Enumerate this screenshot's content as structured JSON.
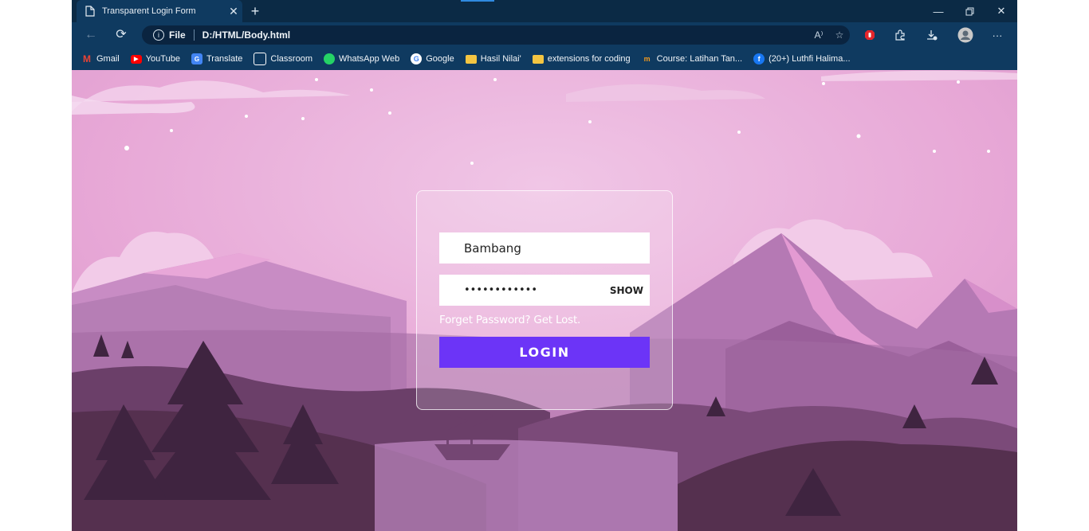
{
  "browser": {
    "tab_title": "Transparent Login Form",
    "new_tab": "+",
    "address": {
      "scheme_label": "File",
      "url": "D:/HTML/Body.html"
    }
  },
  "bookmarks": [
    {
      "label": "Gmail",
      "icon": "gmail-icon",
      "color": "#ea4335"
    },
    {
      "label": "YouTube",
      "icon": "youtube-icon",
      "color": "#ff0000"
    },
    {
      "label": "Translate",
      "icon": "translate-icon",
      "color": "#4285f4"
    },
    {
      "label": "Classroom",
      "icon": "classroom-icon",
      "color": "#f2f2f2"
    },
    {
      "label": "WhatsApp Web",
      "icon": "whatsapp-icon",
      "color": "#25d366"
    },
    {
      "label": "Google",
      "icon": "google-icon",
      "color": "#ffffff"
    },
    {
      "label": "Hasil Nilai'",
      "icon": "folder-icon",
      "color": "#f4c542"
    },
    {
      "label": "extensions for coding",
      "icon": "folder-icon",
      "color": "#f4c542"
    },
    {
      "label": "Course: Latihan Tan...",
      "icon": "course-icon",
      "color": "#f29a1f"
    },
    {
      "label": "(20+) Luthfi Halima...",
      "icon": "facebook-icon",
      "color": "#1877f2"
    }
  ],
  "login_form": {
    "username_value": "Bambang",
    "password_value": "••••••••••••",
    "show_label": "SHOW",
    "forgot_text": "Forget Password? Get Lost.",
    "login_label": "LOGIN",
    "button_color": "#6c34f7"
  }
}
